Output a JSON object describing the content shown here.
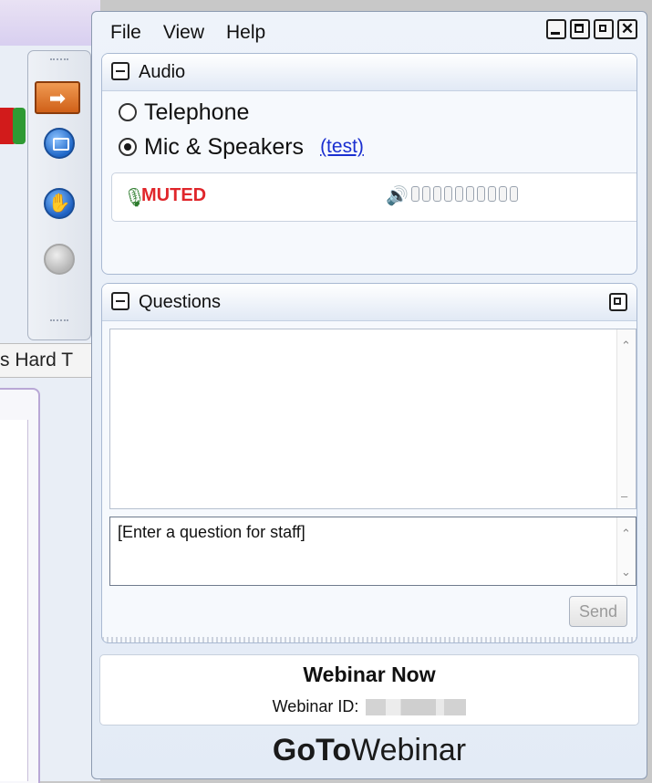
{
  "background": {
    "visible_text": "s Hard T"
  },
  "menu": {
    "file": "File",
    "view": "View",
    "help": "Help"
  },
  "audio": {
    "title": "Audio",
    "option_telephone": "Telephone",
    "option_mic": "Mic & Speakers",
    "selected": "Mic & Speakers",
    "test_link": "(test)",
    "mute_status": "MUTED",
    "volume_level": 0,
    "volume_segments": 10
  },
  "questions": {
    "title": "Questions",
    "input_value": "[Enter a question for staff]",
    "send_label": "Send"
  },
  "webinar": {
    "title": "Webinar Now",
    "id_label": "Webinar ID:"
  },
  "brand": {
    "bold": "GoTo",
    "rest": "Webinar"
  },
  "colors": {
    "muted": "#e0262b",
    "link": "#1a2fd0"
  }
}
